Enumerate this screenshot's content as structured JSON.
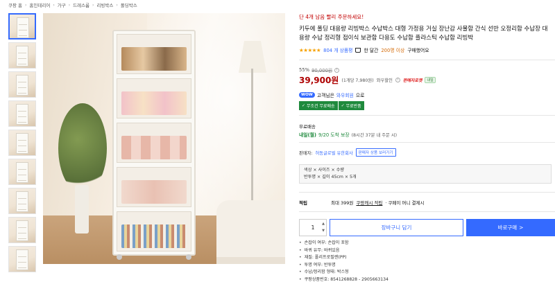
{
  "breadcrumb": [
    "쿠팡 홈",
    "홈인테리어",
    "가구",
    "드레스룸",
    "리빙박스",
    "폴딩박스"
  ],
  "thumbnails_count": 10,
  "urgent_text": "단 4개 남음 빨리 주문하세요!",
  "title": "키두에 폴딩 대용량 리빙박스 수납박스 대형 가정용 거실 장난감 사물함 간식 선반 오정리함 수납장 대용량 수납 정리형 접이식 보관함 다용도 수납함 플라스틱 수납함 리빙박",
  "rating": {
    "stars": "★★★★★",
    "review_text": "804 개 상품평",
    "recent_prefix": "한 달간",
    "recent_count": "200명 이상",
    "recent_suffix": "구매했어요"
  },
  "price": {
    "discount_rate": "55%",
    "original": "90,000원",
    "current": "39,900원",
    "unit": "(1개당 7,980원)",
    "wow_label": "와우할인",
    "rocket": "판매자로켓",
    "rocket_chip": "내일"
  },
  "wow": {
    "badge": "WOW",
    "prefix": "고객님은",
    "member": "와우회원",
    "suffix": "으로"
  },
  "shipping_chips": [
    "무조건 무료배송",
    "무료반품"
  ],
  "shipping": {
    "label": "무료배송",
    "arrive": "내일(월)",
    "date": "9/20 도착 보장",
    "remain": "(8시간 37분 내 주문 시)"
  },
  "seller": {
    "label": "판매자:",
    "name": "허동글로벌 유한회사",
    "button": "판매자 상품 보러가기"
  },
  "options": {
    "line1": "색상 × 사이즈 × 수량",
    "line2": "반투명 × 길이 45cm × 5개"
  },
  "benefit": {
    "label": "적립",
    "prefix": "최대 399원",
    "link": "쿠팡캐시 적립",
    "suffix": "· 쿠페이 머니 결제시"
  },
  "buy": {
    "qty": "1",
    "cart_label": "장바구니 담기",
    "buy_label": "바로구매",
    "buy_arrow": ">"
  },
  "specs": [
    "손잡이 여부: 손잡이 포함",
    "바퀴 유무: 바퀴있음",
    "재질: 폴리프로필렌(PP)",
    "투명 여부: 반투명",
    "수납/정리함 형태: 박스형",
    "쿠팡상품번호: 8541268828 - 2905663134"
  ],
  "colors": {
    "accent": "#346aff",
    "price_red": "#ae0000",
    "urgent_red": "#c20000",
    "green": "#1f8a3d",
    "star": "#f6a100"
  }
}
